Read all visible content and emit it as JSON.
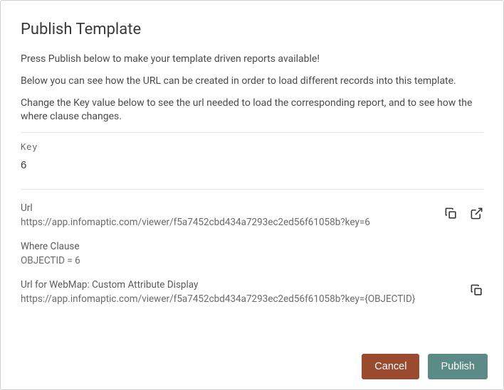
{
  "title": "Publish Template",
  "intro": {
    "p1": "Press Publish below to make your template driven reports available!",
    "p2": "Below you can see how the URL can be created in order to load different records into this template.",
    "p3": "Change the Key value below to see the url needed to load the corresponding report, and to see how the where clause changes."
  },
  "key": {
    "label": "Key",
    "value": "6"
  },
  "url": {
    "label": "Url",
    "value": "https://app.infomaptic.com/viewer/f5a7452cbd434a7293ec2ed56f61058b?key=6"
  },
  "whereClause": {
    "label": "Where Clause",
    "value": "OBJECTID = 6"
  },
  "webmapUrl": {
    "label": "Url for WebMap: Custom Attribute Display",
    "value": "https://app.infomaptic.com/viewer/f5a7452cbd434a7293ec2ed56f61058b?key={OBJECTID}"
  },
  "buttons": {
    "cancel": "Cancel",
    "publish": "Publish"
  }
}
